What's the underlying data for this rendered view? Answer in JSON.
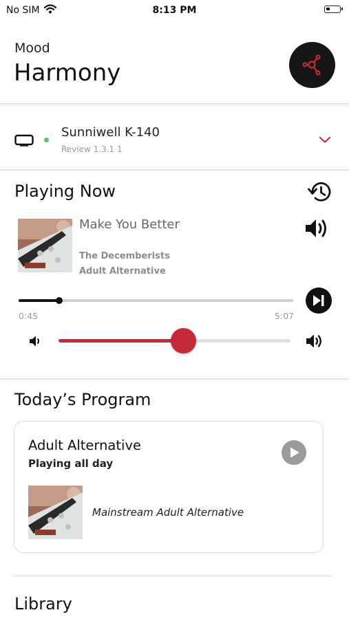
{
  "status_bar": {
    "carrier": "No SIM",
    "time": "8:13 PM"
  },
  "mood": {
    "label": "Mood",
    "title": "Harmony",
    "button_icon": "network-nodes-icon"
  },
  "device": {
    "name": "Sunniwell K-140",
    "version": "Review 1.3.1 1",
    "status_color": "#5cc46a"
  },
  "playing_now": {
    "heading": "Playing Now",
    "track": {
      "title": "Make You Better",
      "artist": "The Decemberists",
      "genre": "Adult Alternative"
    },
    "progress": {
      "current": "0:45",
      "total": "5:07",
      "fraction": 0.147
    },
    "volume": {
      "fraction": 0.54
    }
  },
  "todays_program": {
    "heading": "Today’s Program",
    "card": {
      "title": "Adult Alternative",
      "subtitle": "Playing all day",
      "description": "Mainstream Adult Alternative"
    }
  },
  "library": {
    "heading": "Library"
  },
  "colors": {
    "accent": "#c42b36",
    "dark": "#111111",
    "muted": "#9a9a9a"
  }
}
